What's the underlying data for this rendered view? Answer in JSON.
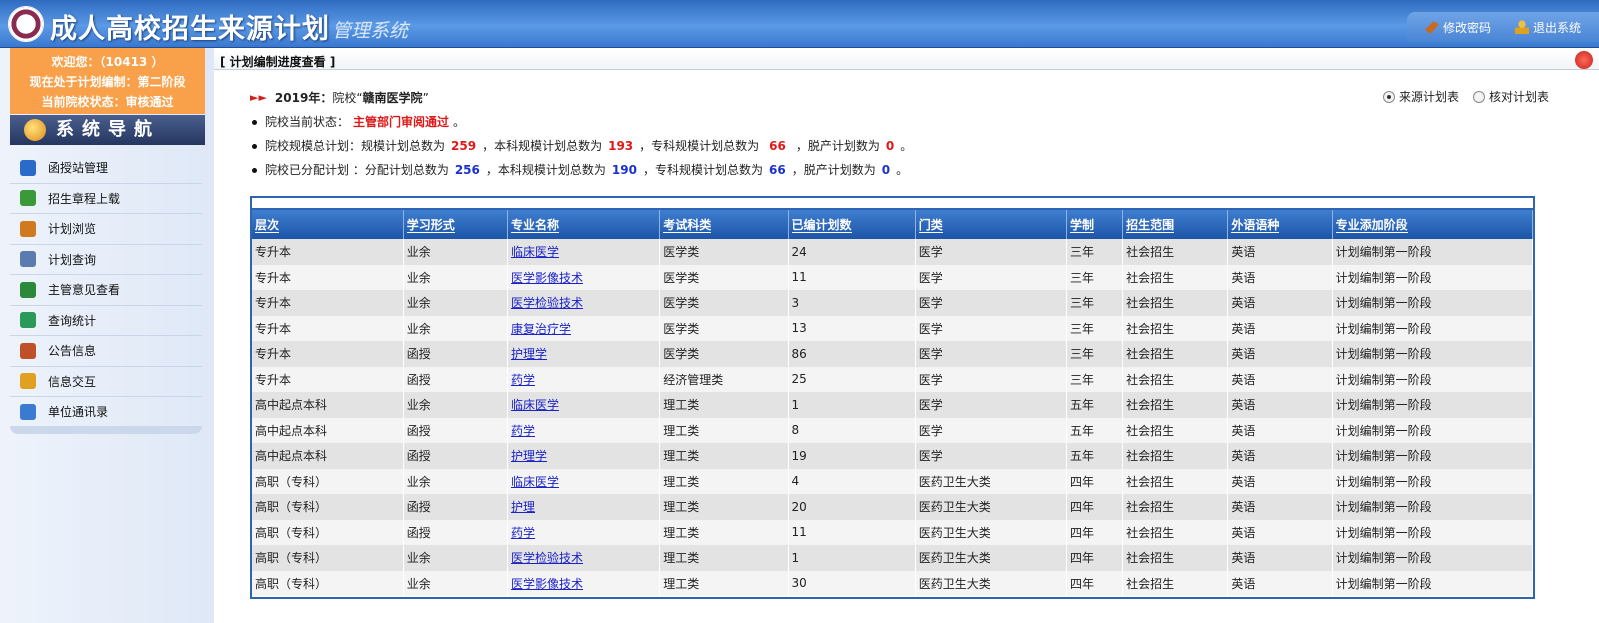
{
  "header": {
    "title": "成人高校招生来源计划",
    "subtitle": "管理系统",
    "change_password": "修改密码",
    "logout": "退出系统"
  },
  "sidebar": {
    "welcome": "欢迎您：（10413 ）",
    "phase": "现在处于计划编制：第二阶段",
    "status": "当前院校状态：审核通过",
    "nav_title": "系统导航",
    "items": [
      {
        "label": "函授站管理",
        "icon": "globe-icon",
        "color": "#2a6ac8"
      },
      {
        "label": "招生章程上载",
        "icon": "upload-icon",
        "color": "#3a9a3a"
      },
      {
        "label": "计划浏览",
        "icon": "table-icon",
        "color": "#d07a20"
      },
      {
        "label": "计划查询",
        "icon": "search-icon",
        "color": "#5a7ab0"
      },
      {
        "label": "主管意见查看",
        "icon": "globe-icon",
        "color": "#2a8a3a"
      },
      {
        "label": "查询统计",
        "icon": "refresh-icon",
        "color": "#2a9a5a"
      },
      {
        "label": "公告信息",
        "icon": "people-icon",
        "color": "#c0502a"
      },
      {
        "label": "信息交互",
        "icon": "mail-icon",
        "color": "#e0a020"
      },
      {
        "label": "单位通讯录",
        "icon": "book-icon",
        "color": "#3a7ad0"
      }
    ]
  },
  "breadcrumb": "[ 计划编制进度查看 ]",
  "info": {
    "year_line_prefix": "2019年：",
    "year_line_mid": "院校“",
    "school": "赣南医学院",
    "year_line_suffix": "”",
    "status_label": "院校当前状态：",
    "status_value": "主管部门审阅通过",
    "status_end": "。",
    "scale_label": "院校规模总计划：规模计划总数为",
    "scale_total": "259",
    "scale_benke_label": "，本科规模计划总数为",
    "scale_benke": "193",
    "scale_zhuanke_label": "，专科规模计划总数为",
    "scale_zhuanke": "66",
    "scale_tuochan_label": "，脱产计划数为",
    "scale_tuochan": "0",
    "scale_end": "。",
    "alloc_label": "院校已分配计划 ：分配计划总数为",
    "alloc_total": "256",
    "alloc_benke_label": "，本科规模计划总数为",
    "alloc_benke": "190",
    "alloc_zhuanke_label": "，专科规模计划总数为",
    "alloc_zhuanke": "66",
    "alloc_tuochan_label": "，脱产计划数为",
    "alloc_tuochan": "0",
    "alloc_end": "。"
  },
  "radios": {
    "source": "来源计划表",
    "check": "核对计划表",
    "selected": "source"
  },
  "table": {
    "headers": [
      "层次",
      "学习形式",
      "专业名称",
      "考试科类",
      "已编计划数",
      "门类",
      "学制",
      "招生范围",
      "外语语种",
      "专业添加阶段"
    ],
    "rows": [
      [
        "专升本",
        "业余",
        "临床医学",
        "医学类",
        "24",
        "医学",
        "三年",
        "社会招生",
        "英语",
        "计划编制第一阶段"
      ],
      [
        "专升本",
        "业余",
        "医学影像技术",
        "医学类",
        "11",
        "医学",
        "三年",
        "社会招生",
        "英语",
        "计划编制第一阶段"
      ],
      [
        "专升本",
        "业余",
        "医学检验技术",
        "医学类",
        "3",
        "医学",
        "三年",
        "社会招生",
        "英语",
        "计划编制第一阶段"
      ],
      [
        "专升本",
        "业余",
        "康复治疗学",
        "医学类",
        "13",
        "医学",
        "三年",
        "社会招生",
        "英语",
        "计划编制第一阶段"
      ],
      [
        "专升本",
        "函授",
        "护理学",
        "医学类",
        "86",
        "医学",
        "三年",
        "社会招生",
        "英语",
        "计划编制第一阶段"
      ],
      [
        "专升本",
        "函授",
        "药学",
        "经济管理类",
        "25",
        "医学",
        "三年",
        "社会招生",
        "英语",
        "计划编制第一阶段"
      ],
      [
        "高中起点本科",
        "业余",
        "临床医学",
        "理工类",
        "1",
        "医学",
        "五年",
        "社会招生",
        "英语",
        "计划编制第一阶段"
      ],
      [
        "高中起点本科",
        "函授",
        "药学",
        "理工类",
        "8",
        "医学",
        "五年",
        "社会招生",
        "英语",
        "计划编制第一阶段"
      ],
      [
        "高中起点本科",
        "函授",
        "护理学",
        "理工类",
        "19",
        "医学",
        "五年",
        "社会招生",
        "英语",
        "计划编制第一阶段"
      ],
      [
        "高职（专科）",
        "业余",
        "临床医学",
        "理工类",
        "4",
        "医药卫生大类",
        "四年",
        "社会招生",
        "英语",
        "计划编制第一阶段"
      ],
      [
        "高职（专科）",
        "函授",
        "护理",
        "理工类",
        "20",
        "医药卫生大类",
        "四年",
        "社会招生",
        "英语",
        "计划编制第一阶段"
      ],
      [
        "高职（专科）",
        "函授",
        "药学",
        "理工类",
        "11",
        "医药卫生大类",
        "四年",
        "社会招生",
        "英语",
        "计划编制第一阶段"
      ],
      [
        "高职（专科）",
        "业余",
        "医学检验技术",
        "理工类",
        "1",
        "医药卫生大类",
        "四年",
        "社会招生",
        "英语",
        "计划编制第一阶段"
      ],
      [
        "高职（专科）",
        "业余",
        "医学影像技术",
        "理工类",
        "30",
        "医药卫生大类",
        "四年",
        "社会招生",
        "英语",
        "计划编制第一阶段"
      ]
    ]
  }
}
